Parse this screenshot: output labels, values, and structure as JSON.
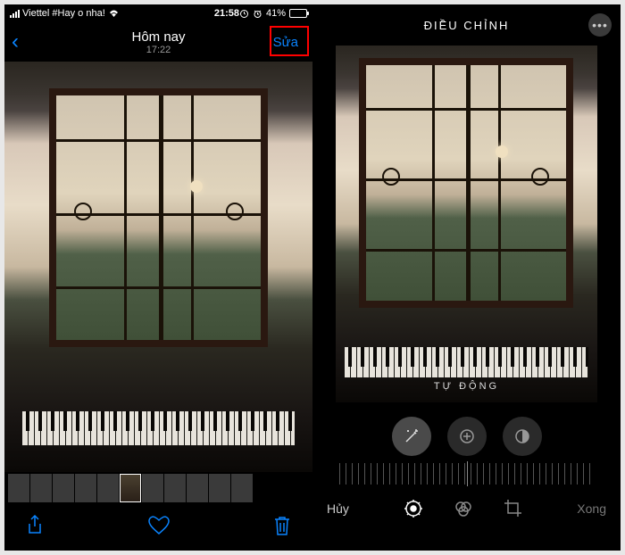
{
  "status": {
    "carrier": "Viettel #Hay o nha!",
    "wifi": "wifi-icon",
    "time": "21:58",
    "orientation_lock": "lock-icon",
    "alarm": "alarm-icon",
    "battery_percent": "41%"
  },
  "viewer": {
    "back": "‹",
    "title": "Hôm nay",
    "subtitle": "17:22",
    "edit_label": "Sửa"
  },
  "toolbar": {
    "share": "share-icon",
    "heart": "heart-icon",
    "trash": "trash-icon"
  },
  "editor": {
    "header": "ĐIỀU CHỈNH",
    "more": "•••",
    "auto_label": "TỰ ĐỘNG",
    "cancel": "Hủy",
    "done": "Xong"
  }
}
